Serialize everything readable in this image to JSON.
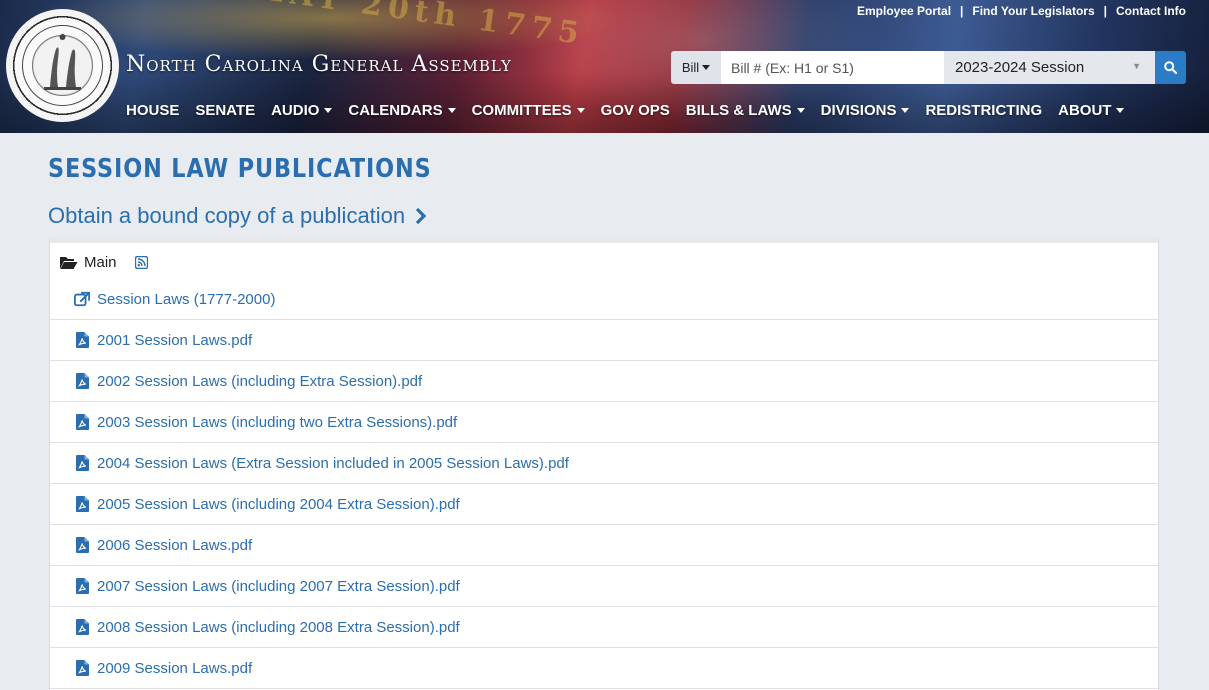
{
  "header": {
    "site_title": "North Carolina General Assembly",
    "flag_text": "MAY 20th 1775",
    "top_links": [
      "Employee Portal",
      "Find Your Legislators",
      "Contact Info"
    ],
    "search": {
      "bill_type": "Bill",
      "placeholder": "Bill # (Ex: H1 or S1)",
      "session": "2023-2024 Session"
    },
    "nav": [
      {
        "label": "HOUSE",
        "dropdown": false
      },
      {
        "label": "SENATE",
        "dropdown": false
      },
      {
        "label": "AUDIO",
        "dropdown": true
      },
      {
        "label": "CALENDARS",
        "dropdown": true
      },
      {
        "label": "COMMITTEES",
        "dropdown": true
      },
      {
        "label": "GOV OPS",
        "dropdown": false
      },
      {
        "label": "BILLS & LAWS",
        "dropdown": true
      },
      {
        "label": "DIVISIONS",
        "dropdown": true
      },
      {
        "label": "REDISTRICTING",
        "dropdown": false
      },
      {
        "label": "ABOUT",
        "dropdown": true
      }
    ]
  },
  "main": {
    "title": "SESSION LAW PUBLICATIONS",
    "obtain_link": "Obtain a bound copy of a publication",
    "folder": {
      "label": "Main",
      "icon": "folder-open-icon"
    },
    "external_link": {
      "label": "Session Laws (1777-2000)",
      "icon": "external-link-icon"
    },
    "files": [
      "2001 Session Laws.pdf",
      "2002 Session Laws (including Extra Session).pdf",
      "2003 Session Laws (including two Extra Sessions).pdf",
      "2004 Session Laws (Extra Session included in 2005 Session Laws).pdf",
      "2005 Session Laws (including 2004 Extra Session).pdf",
      "2006 Session Laws.pdf",
      "2007 Session Laws (including 2007 Extra Session).pdf",
      "2008 Session Laws (including 2008 Extra Session).pdf",
      "2009 Session Laws.pdf"
    ]
  },
  "colors": {
    "link": "#2b6eb0",
    "search_button": "#2a7cc7",
    "page_background": "#e8ecf0"
  }
}
